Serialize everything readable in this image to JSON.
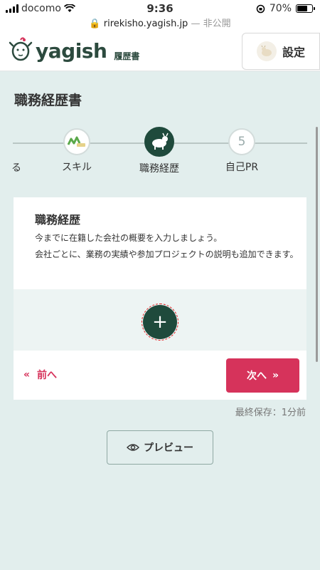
{
  "status_bar": {
    "carrier": "docomo",
    "time": "9:36",
    "battery": "70%",
    "battery_level": 0.7
  },
  "url_bar": {
    "domain": "rirekisho.yagish.jp",
    "suffix": " — 非公開"
  },
  "header": {
    "logo_text": "yagish",
    "logo_sub": "履歴書",
    "settings_label": "設定"
  },
  "main": {
    "page_title": "職務経歴書",
    "stepper": {
      "partial_label": "る",
      "steps": [
        {
          "label": "スキル",
          "icon": "skill-icon"
        },
        {
          "label": "職務経歴",
          "icon": "goat-icon",
          "active": true
        },
        {
          "label": "自己PR",
          "number": "5"
        }
      ]
    },
    "card": {
      "title": "職務経歴",
      "desc_line1": "今までに在籍した会社の概要を入力しましょう。",
      "desc_line2": "会社ごとに、業務の実績や参加プロジェクトの説明も追加できます。",
      "add_label": "+",
      "prev_label": "前へ",
      "next_label": "次へ"
    },
    "save_status": "最終保存：1分前",
    "preview_label": "プレビュー"
  },
  "colors": {
    "brand_green": "#1f4a3c",
    "accent_pink": "#d6335b",
    "background": "#e2eeed"
  }
}
